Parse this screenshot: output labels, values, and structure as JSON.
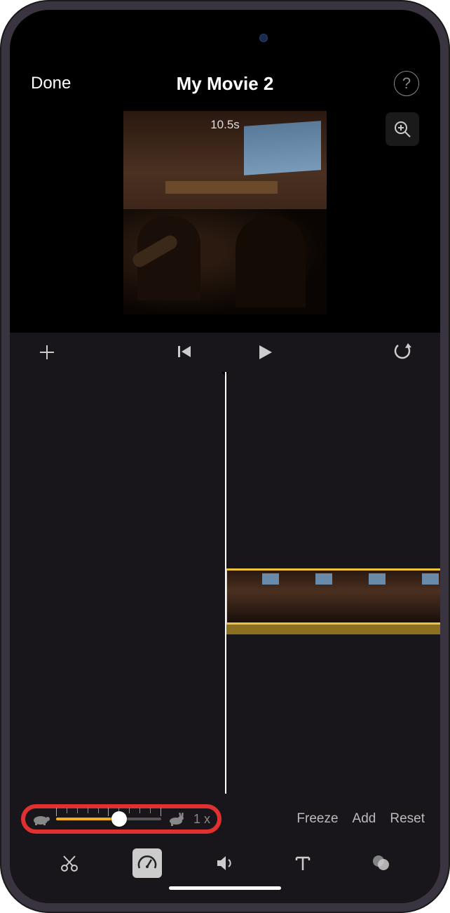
{
  "topbar": {
    "done_label": "Done",
    "title": "My Movie 2"
  },
  "preview": {
    "duration": "10.5s"
  },
  "speed": {
    "multiplier": "1 x",
    "freeze_label": "Freeze",
    "add_label": "Add",
    "reset_label": "Reset"
  }
}
